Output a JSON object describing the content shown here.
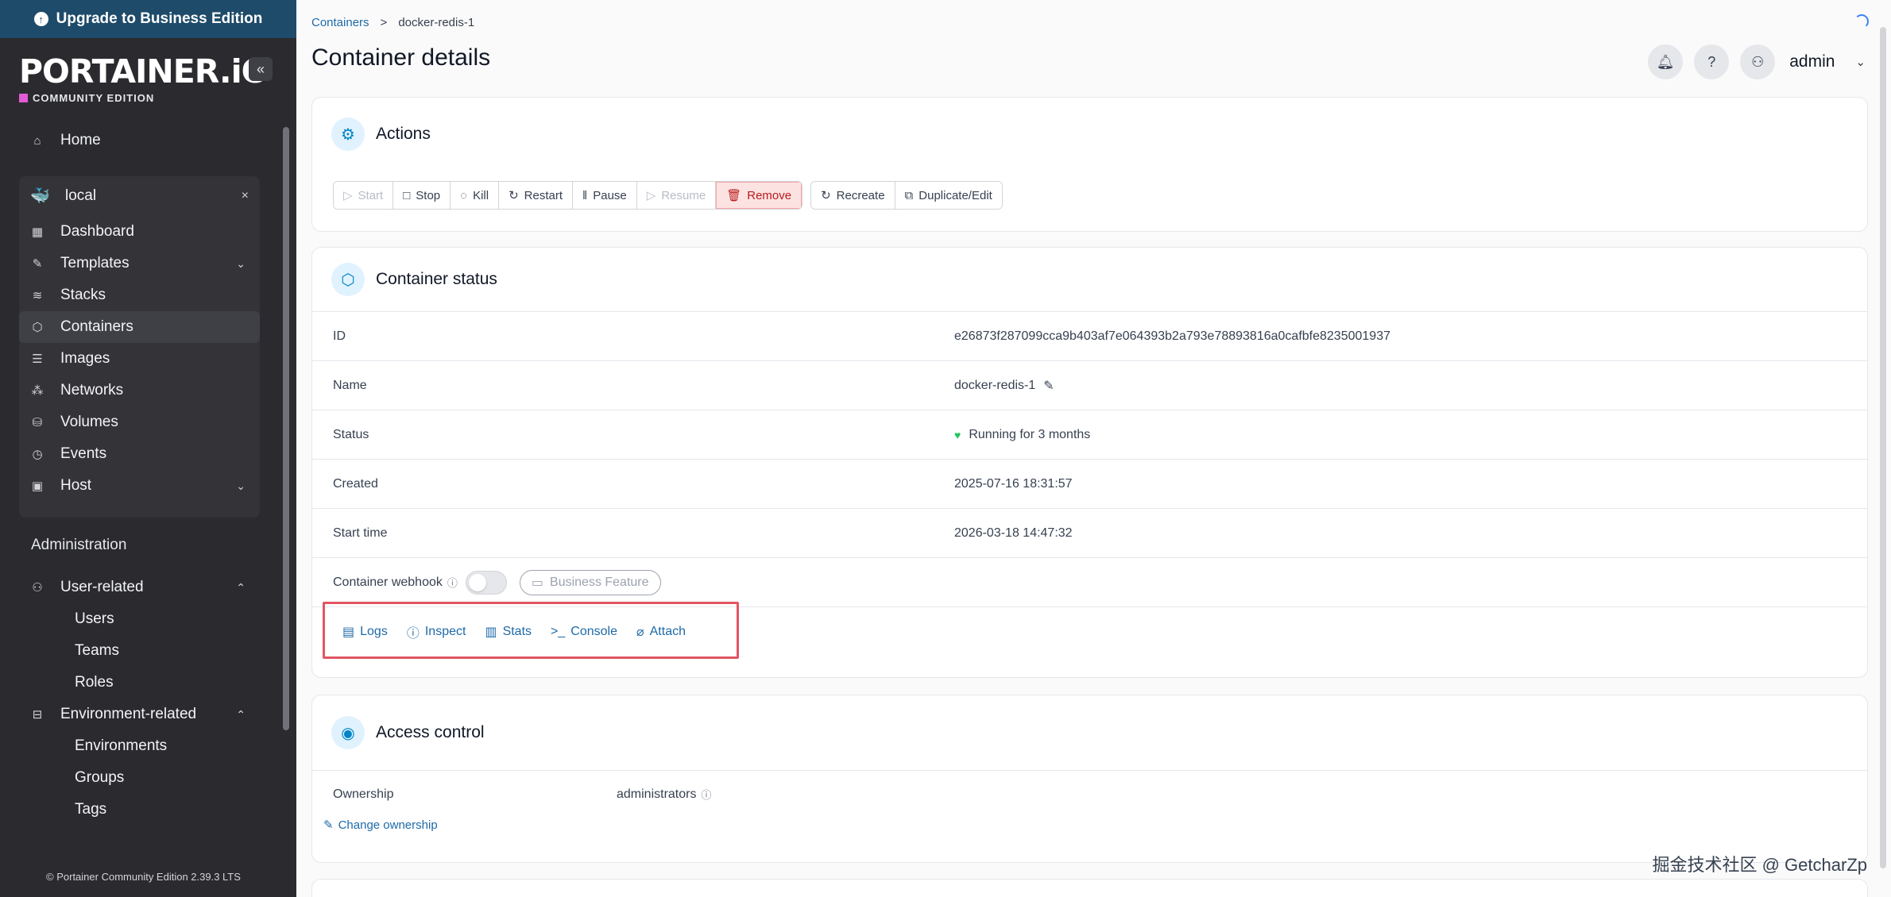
{
  "sidebar": {
    "upgrade_label": "Upgrade to Business Edition",
    "brand_name": "PORTAINER.iO",
    "brand_edition": "COMMUNITY EDITION",
    "home_label": "Home",
    "env_name": "local",
    "env_items": [
      {
        "label": "Dashboard"
      },
      {
        "label": "Templates"
      },
      {
        "label": "Stacks"
      },
      {
        "label": "Containers"
      },
      {
        "label": "Images"
      },
      {
        "label": "Networks"
      },
      {
        "label": "Volumes"
      },
      {
        "label": "Events"
      },
      {
        "label": "Host"
      }
    ],
    "admin_label": "Administration",
    "user_related": "User-related",
    "user_sub": [
      "Users",
      "Teams",
      "Roles"
    ],
    "env_related": "Environment-related",
    "env_sub": [
      "Environments",
      "Groups",
      "Tags"
    ],
    "footer": "Portainer Community Edition 2.39.3 LTS"
  },
  "header": {
    "breadcrumb_root": "Containers",
    "breadcrumb_sep": ">",
    "breadcrumb_current": "docker-redis-1",
    "page_title": "Container details",
    "user_name": "admin"
  },
  "actions": {
    "title": "Actions",
    "buttons": [
      "Start",
      "Stop",
      "Kill",
      "Restart",
      "Pause",
      "Resume",
      "Remove"
    ],
    "buttons2": [
      "Recreate",
      "Duplicate/Edit"
    ]
  },
  "status": {
    "title": "Container status",
    "rows": [
      {
        "key": "ID",
        "value": "e26873f287099cca9b403af7e064393b2a793e78893816a0cafbfe8235001937"
      },
      {
        "key": "Name",
        "value": "docker-redis-1"
      },
      {
        "key": "Status",
        "value": "Running for 3 months"
      },
      {
        "key": "Created",
        "value": "2025-07-16 18:31:57"
      },
      {
        "key": "Start time",
        "value": "2026-03-18 14:47:32"
      }
    ],
    "webhook_label": "Container webhook",
    "business_feature": "Business Feature",
    "quick_links": [
      "Logs",
      "Inspect",
      "Stats",
      "Console",
      "Attach"
    ]
  },
  "access": {
    "title": "Access control",
    "ownership_label": "Ownership",
    "ownership_value": "administrators",
    "change_link": "Change ownership"
  },
  "watermark": "掘金技术社区 @ GetcharZp"
}
